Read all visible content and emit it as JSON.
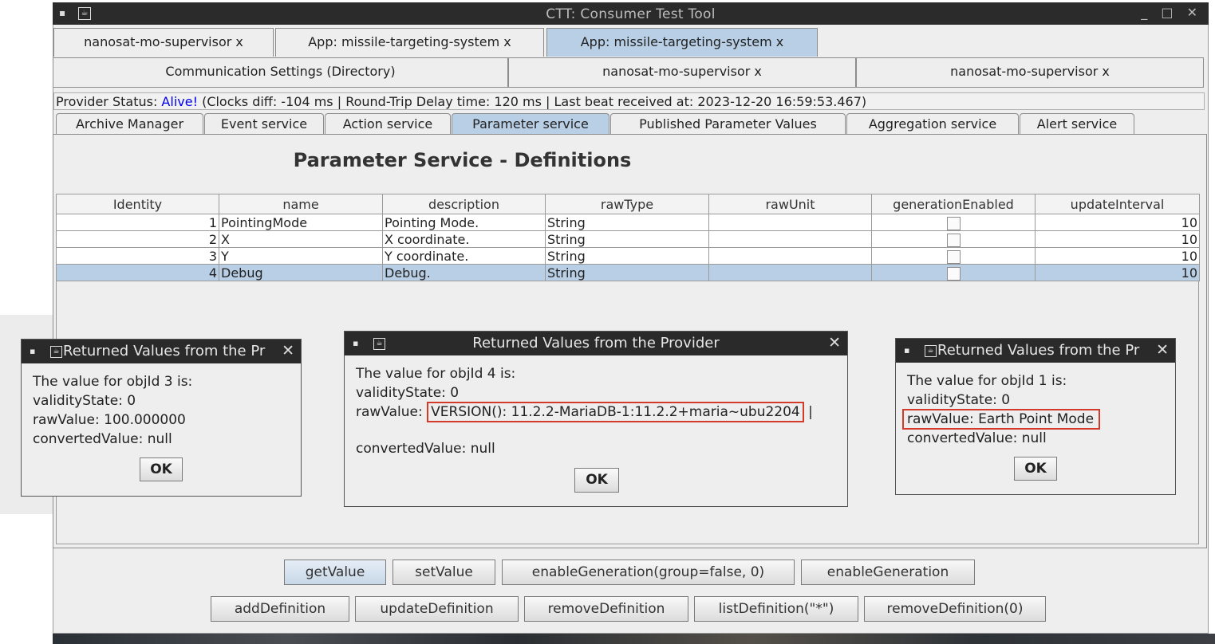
{
  "window": {
    "title": "CTT: Consumer Test Tool",
    "controls": "_ □ ✕"
  },
  "top_tabs": [
    {
      "label": "nanosat-mo-supervisor x"
    },
    {
      "label": "App: missile-targeting-system x"
    },
    {
      "label": "App: missile-targeting-system x"
    }
  ],
  "second_tabs": [
    {
      "label": "Communication Settings (Directory)"
    },
    {
      "label": "nanosat-mo-supervisor x"
    },
    {
      "label": "nanosat-mo-supervisor x"
    }
  ],
  "status": {
    "prefix": "Provider Status: ",
    "alive": "Alive!",
    "details": " (Clocks diff: -104 ms | Round-Trip Delay time: 120 ms | Last beat received at: 2023-12-20 16:59:53.467)"
  },
  "service_tabs": [
    {
      "label": "Archive Manager"
    },
    {
      "label": "Event service"
    },
    {
      "label": "Action service"
    },
    {
      "label": "Parameter service"
    },
    {
      "label": "Published Parameter Values"
    },
    {
      "label": "Aggregation service"
    },
    {
      "label": "Alert service"
    }
  ],
  "page_title": "Parameter Service - Definitions",
  "table": {
    "headers": [
      "Identity",
      "name",
      "description",
      "rawType",
      "rawUnit",
      "generationEnabled",
      "updateInterval"
    ],
    "rows": [
      {
        "identity": "1",
        "name": "PointingMode",
        "description": "Pointing Mode.",
        "rawType": "String",
        "rawUnit": "",
        "updateInterval": "10"
      },
      {
        "identity": "2",
        "name": "X",
        "description": "X coordinate.",
        "rawType": "String",
        "rawUnit": "",
        "updateInterval": "10"
      },
      {
        "identity": "3",
        "name": "Y",
        "description": "Y coordinate.",
        "rawType": "String",
        "rawUnit": "",
        "updateInterval": "10"
      },
      {
        "identity": "4",
        "name": "Debug",
        "description": "Debug.",
        "rawType": "String",
        "rawUnit": "",
        "updateInterval": "10"
      }
    ]
  },
  "dialogs": {
    "left": {
      "title": "Returned Values from the Pr",
      "line1": "The value for objId 3 is:",
      "line2": "validityState: 0",
      "line3": "rawValue: 100.000000",
      "line4": "convertedValue: null",
      "ok": "OK"
    },
    "center": {
      "title": "Returned Values from the Provider",
      "line1": "The value for objId 4 is:",
      "line2": "validityState: 0",
      "raw_prefix": "rawValue: ",
      "raw_value": "VERSION(): 11.2.2-MariaDB-1:11.2.2+maria~ubu2204",
      "line4": "convertedValue: null",
      "ok": "OK"
    },
    "right": {
      "title": "Returned Values from the Pr",
      "line1": "The value for objId 1 is:",
      "line2": "validityState: 0",
      "line3": "rawValue: Earth Point Mode",
      "line4": "convertedValue: null",
      "ok": "OK"
    }
  },
  "buttons_row1": [
    {
      "label": "getValue"
    },
    {
      "label": "setValue"
    },
    {
      "label": "enableGeneration(group=false, 0)"
    },
    {
      "label": "enableGeneration"
    }
  ],
  "buttons_row2": [
    {
      "label": "addDefinition"
    },
    {
      "label": "updateDefinition"
    },
    {
      "label": "removeDefinition"
    },
    {
      "label": "listDefinition(\"*\")"
    },
    {
      "label": "removeDefinition(0)"
    }
  ],
  "colors": {
    "selected_tab": "#b8cfe5",
    "titlebar": "#2b2b2b",
    "highlight_box": "#d23a2a",
    "alive_link": "#0000ee"
  }
}
